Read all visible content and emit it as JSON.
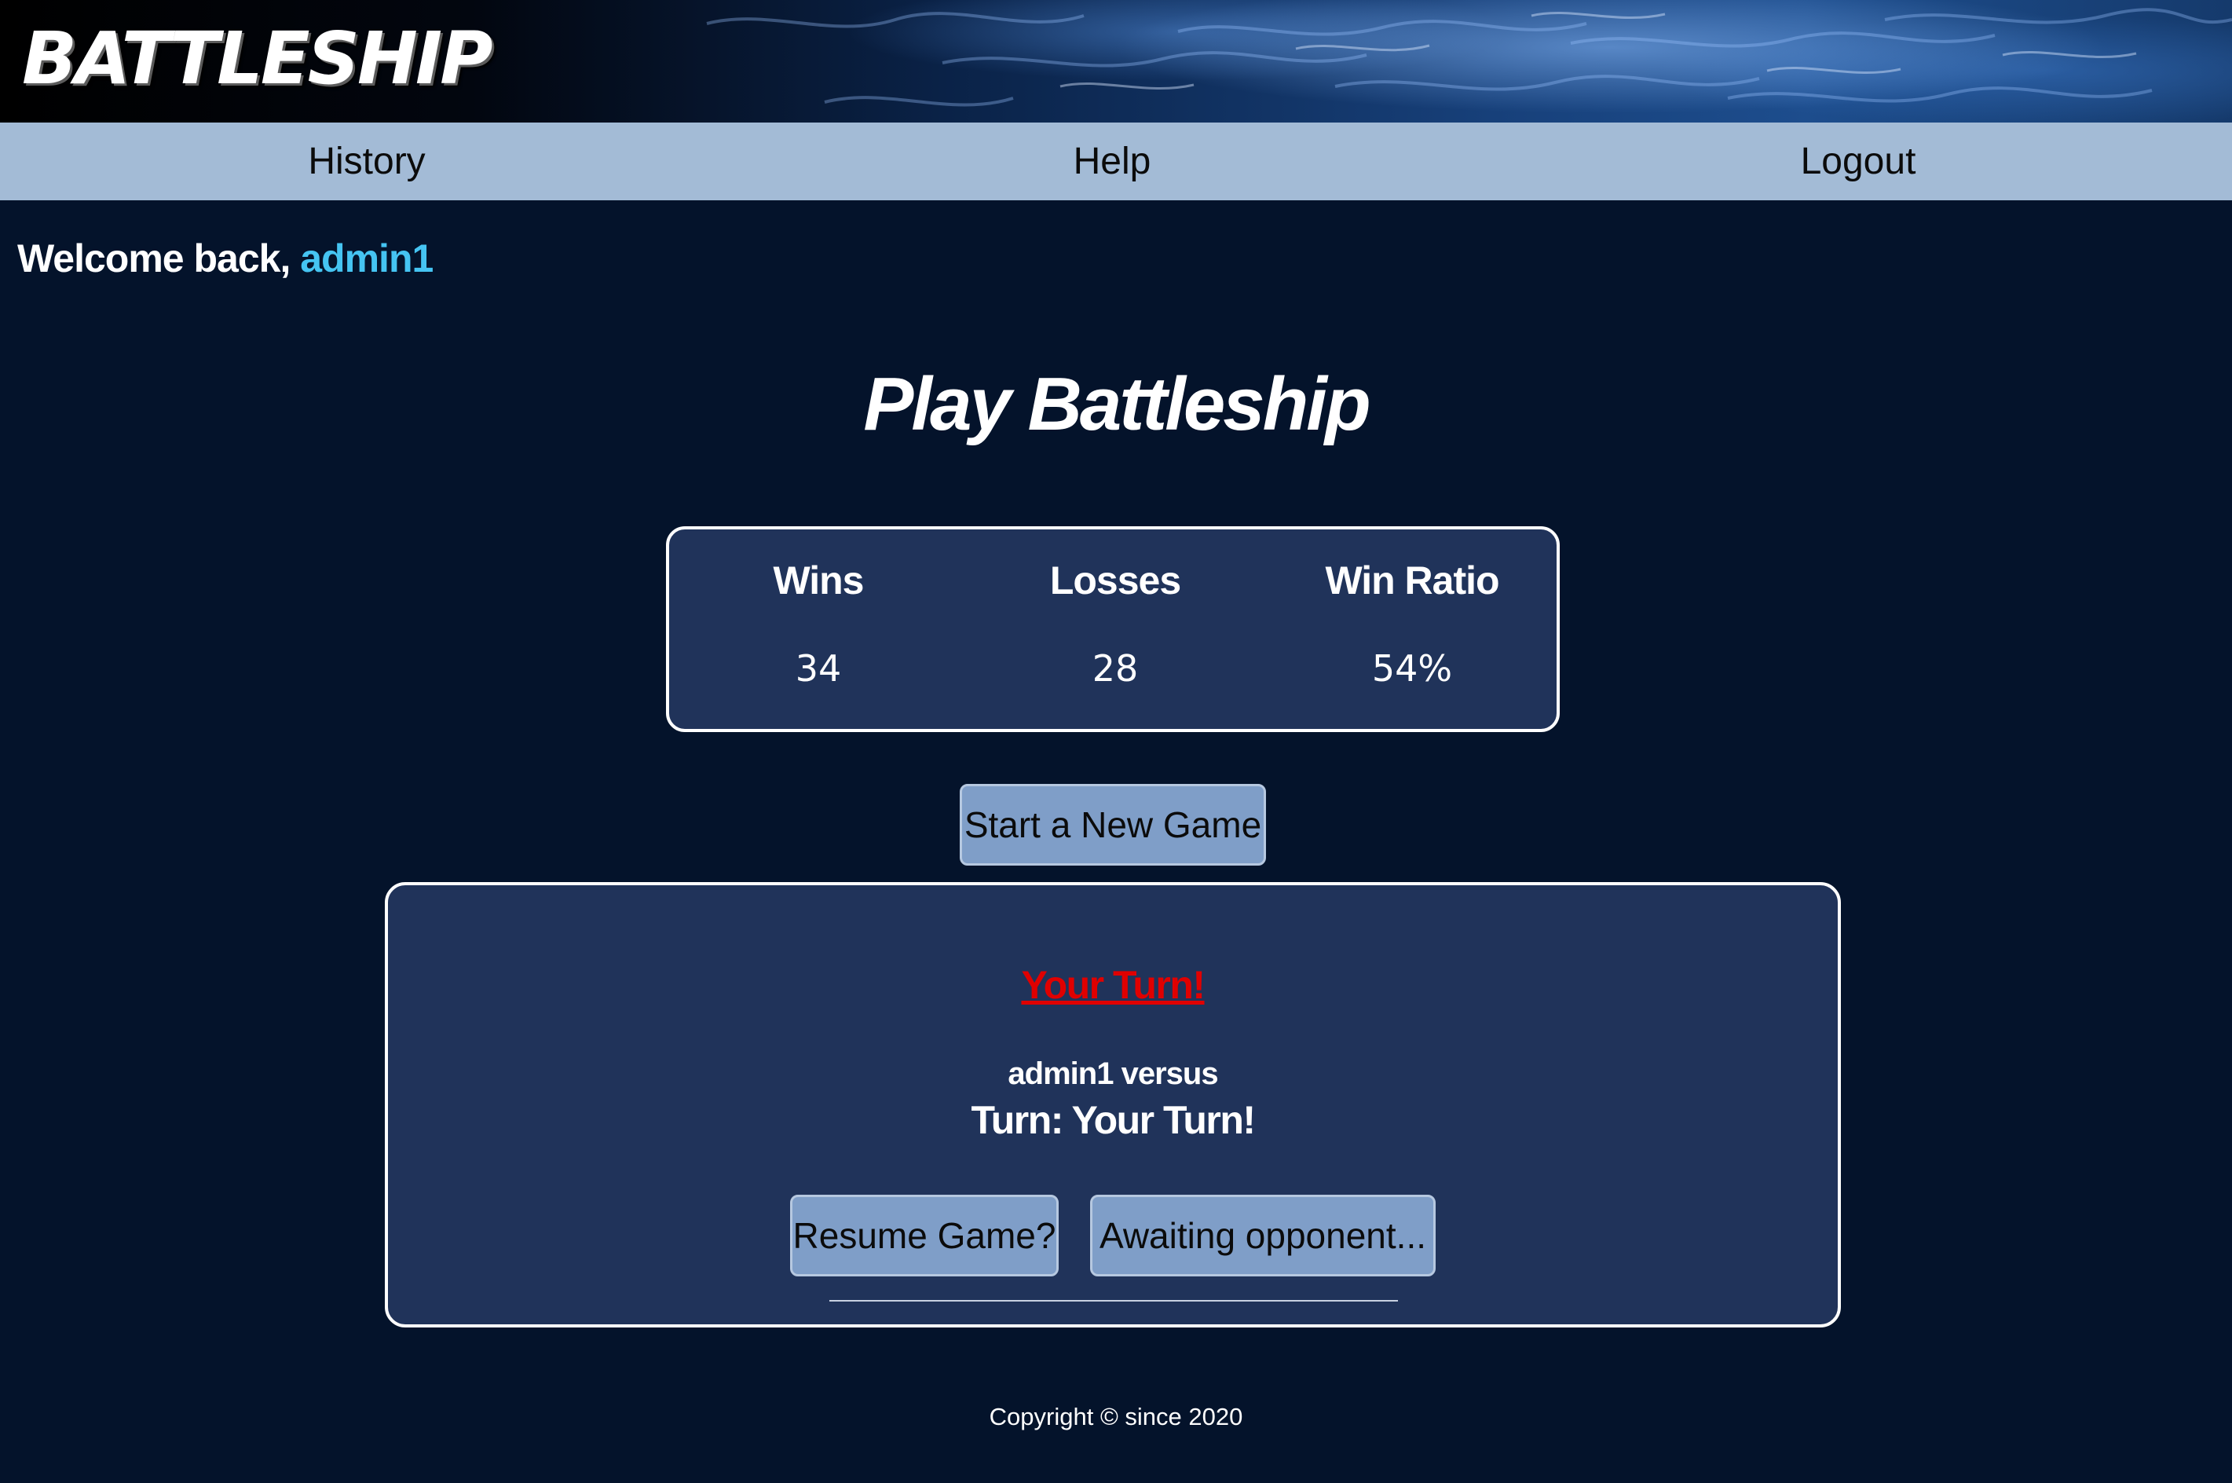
{
  "header": {
    "logo_text": "BATTLESHIP"
  },
  "nav": {
    "items": [
      {
        "label": "History"
      },
      {
        "label": "Help"
      },
      {
        "label": "Logout"
      }
    ],
    "background_color": "#a3bbd6"
  },
  "welcome": {
    "prefix": "Welcome back, ",
    "username": "admin1",
    "username_color": "#45c4f2"
  },
  "page": {
    "title": "Play Battleship",
    "background_color": "#04132b"
  },
  "stats": {
    "columns": [
      {
        "label": "Wins",
        "value": "34"
      },
      {
        "label": "Losses",
        "value": "28"
      },
      {
        "label": "Win Ratio",
        "value": "54%"
      }
    ]
  },
  "actions": {
    "new_game_label": "Start a New Game"
  },
  "game": {
    "turn_link": "Your Turn!",
    "turn_link_color": "#e00000",
    "matchup": "admin1 versus",
    "turn_status": "Turn: Your Turn!",
    "resume_label": "Resume Game?",
    "awaiting_label": "Awaiting opponent..."
  },
  "footer": {
    "copyright": "Copyright © since 2020"
  }
}
